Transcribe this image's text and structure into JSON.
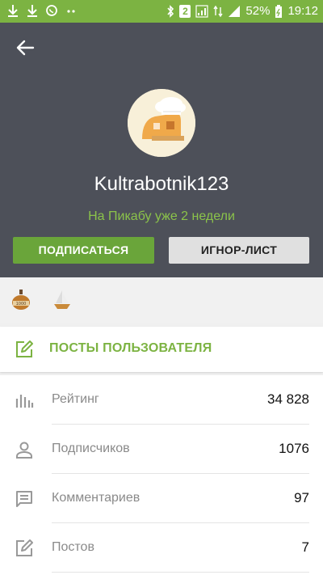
{
  "status_bar": {
    "battery": "52%",
    "time": "19:12",
    "sim_badge": "2"
  },
  "profile": {
    "username": "Kultrabotnik123",
    "since": "На Пикабу уже 2 недели",
    "subscribe_label": "ПОДПИСАТЬСЯ",
    "ignore_label": "ИГНОР-ЛИСТ"
  },
  "badges": [
    {
      "icon": "medal-1000-icon"
    },
    {
      "icon": "ship-award-icon"
    }
  ],
  "posts_link": {
    "label": "ПОСТЫ ПОЛЬЗОВАТЕЛЯ",
    "icon": "edit-icon"
  },
  "stats": [
    {
      "label": "Рейтинг",
      "value": "34 828",
      "icon": "bar-chart-icon"
    },
    {
      "label": "Подписчиков",
      "value": "1076",
      "icon": "person-icon"
    },
    {
      "label": "Комментариев",
      "value": "97",
      "icon": "comment-icon"
    },
    {
      "label": "Постов",
      "value": "7",
      "icon": "edit-icon"
    }
  ],
  "colors": {
    "accent": "#7cb342",
    "header_bg": "#4d5059"
  }
}
